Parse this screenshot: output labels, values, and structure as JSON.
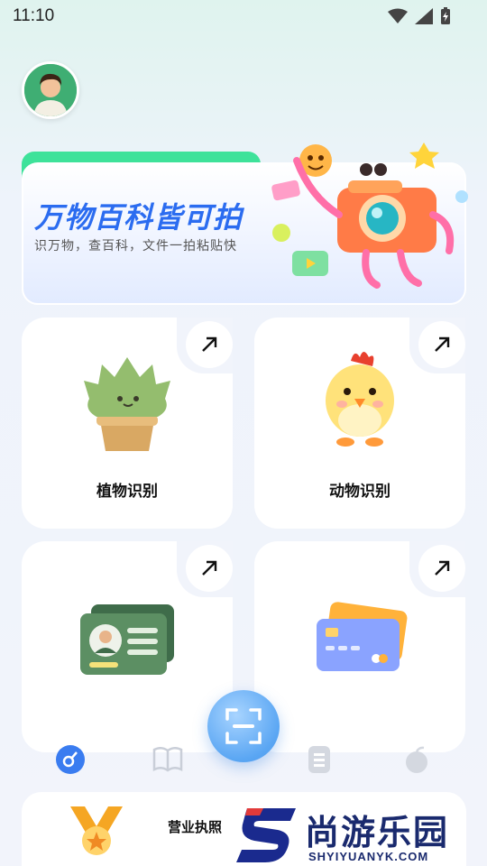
{
  "status_bar": {
    "time": "11:10"
  },
  "banner": {
    "title": "万物百科皆可拍",
    "subtitle": "识万物，查百科，文件一拍粘贴快"
  },
  "cards": [
    {
      "label": "植物识别",
      "icon": "plant-icon"
    },
    {
      "label": "动物识别",
      "icon": "chick-icon"
    },
    {
      "label": "",
      "icon": "id-card-icon"
    },
    {
      "label": "",
      "icon": "bank-card-icon"
    }
  ],
  "nav": {
    "items": [
      "home-icon",
      "book-icon",
      "list-icon",
      "fruit-icon"
    ]
  },
  "bottom": {
    "license_label": "营业执照"
  },
  "watermark": {
    "brand": "尚游乐园",
    "url": "SHYIYUANYK.COM"
  },
  "colors": {
    "accent": "#2b6cf0",
    "green_tab": "#3ee29a",
    "scan": "#5aa6f3"
  }
}
